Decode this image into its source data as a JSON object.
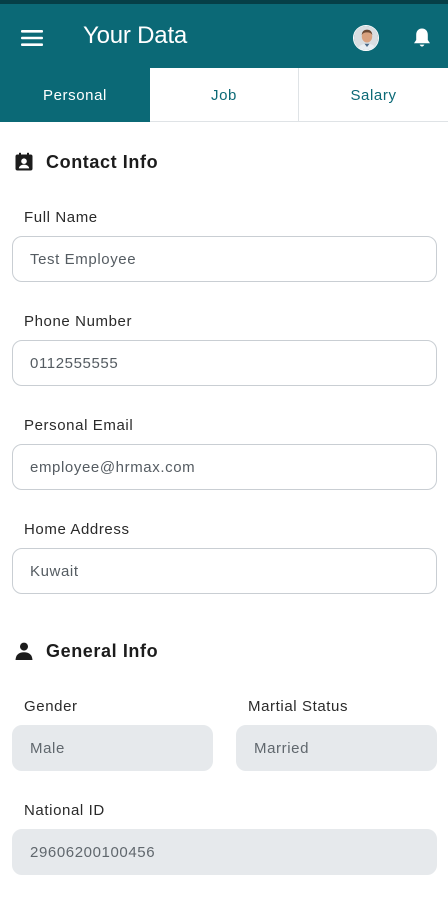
{
  "appbar": {
    "title": "Your Data",
    "icons": {
      "menu": "hamburger-menu-icon",
      "avatar": "user-avatar",
      "notifications": "bell-icon"
    },
    "colors": {
      "primary": "#0b6976",
      "primary_dark": "#063f47"
    }
  },
  "tabs": [
    {
      "label": "Personal",
      "active": true
    },
    {
      "label": "Job",
      "active": false
    },
    {
      "label": "Salary",
      "active": false
    }
  ],
  "contact": {
    "title": "Contact Info",
    "icon": "contact-card-icon",
    "full_name": {
      "label": "Full Name",
      "value": "Test Employee"
    },
    "phone": {
      "label": "Phone Number",
      "value": "0112555555"
    },
    "email": {
      "label": "Personal Email",
      "value": "employee@hrmax.com"
    },
    "address": {
      "label": "Home Address",
      "value": "Kuwait"
    }
  },
  "general": {
    "title": "General Info",
    "icon": "person-icon",
    "gender": {
      "label": "Gender",
      "value": "Male"
    },
    "marital": {
      "label": "Martial Status",
      "value": "Married"
    },
    "national_id": {
      "label": "National ID",
      "value": "29606200100456"
    }
  }
}
